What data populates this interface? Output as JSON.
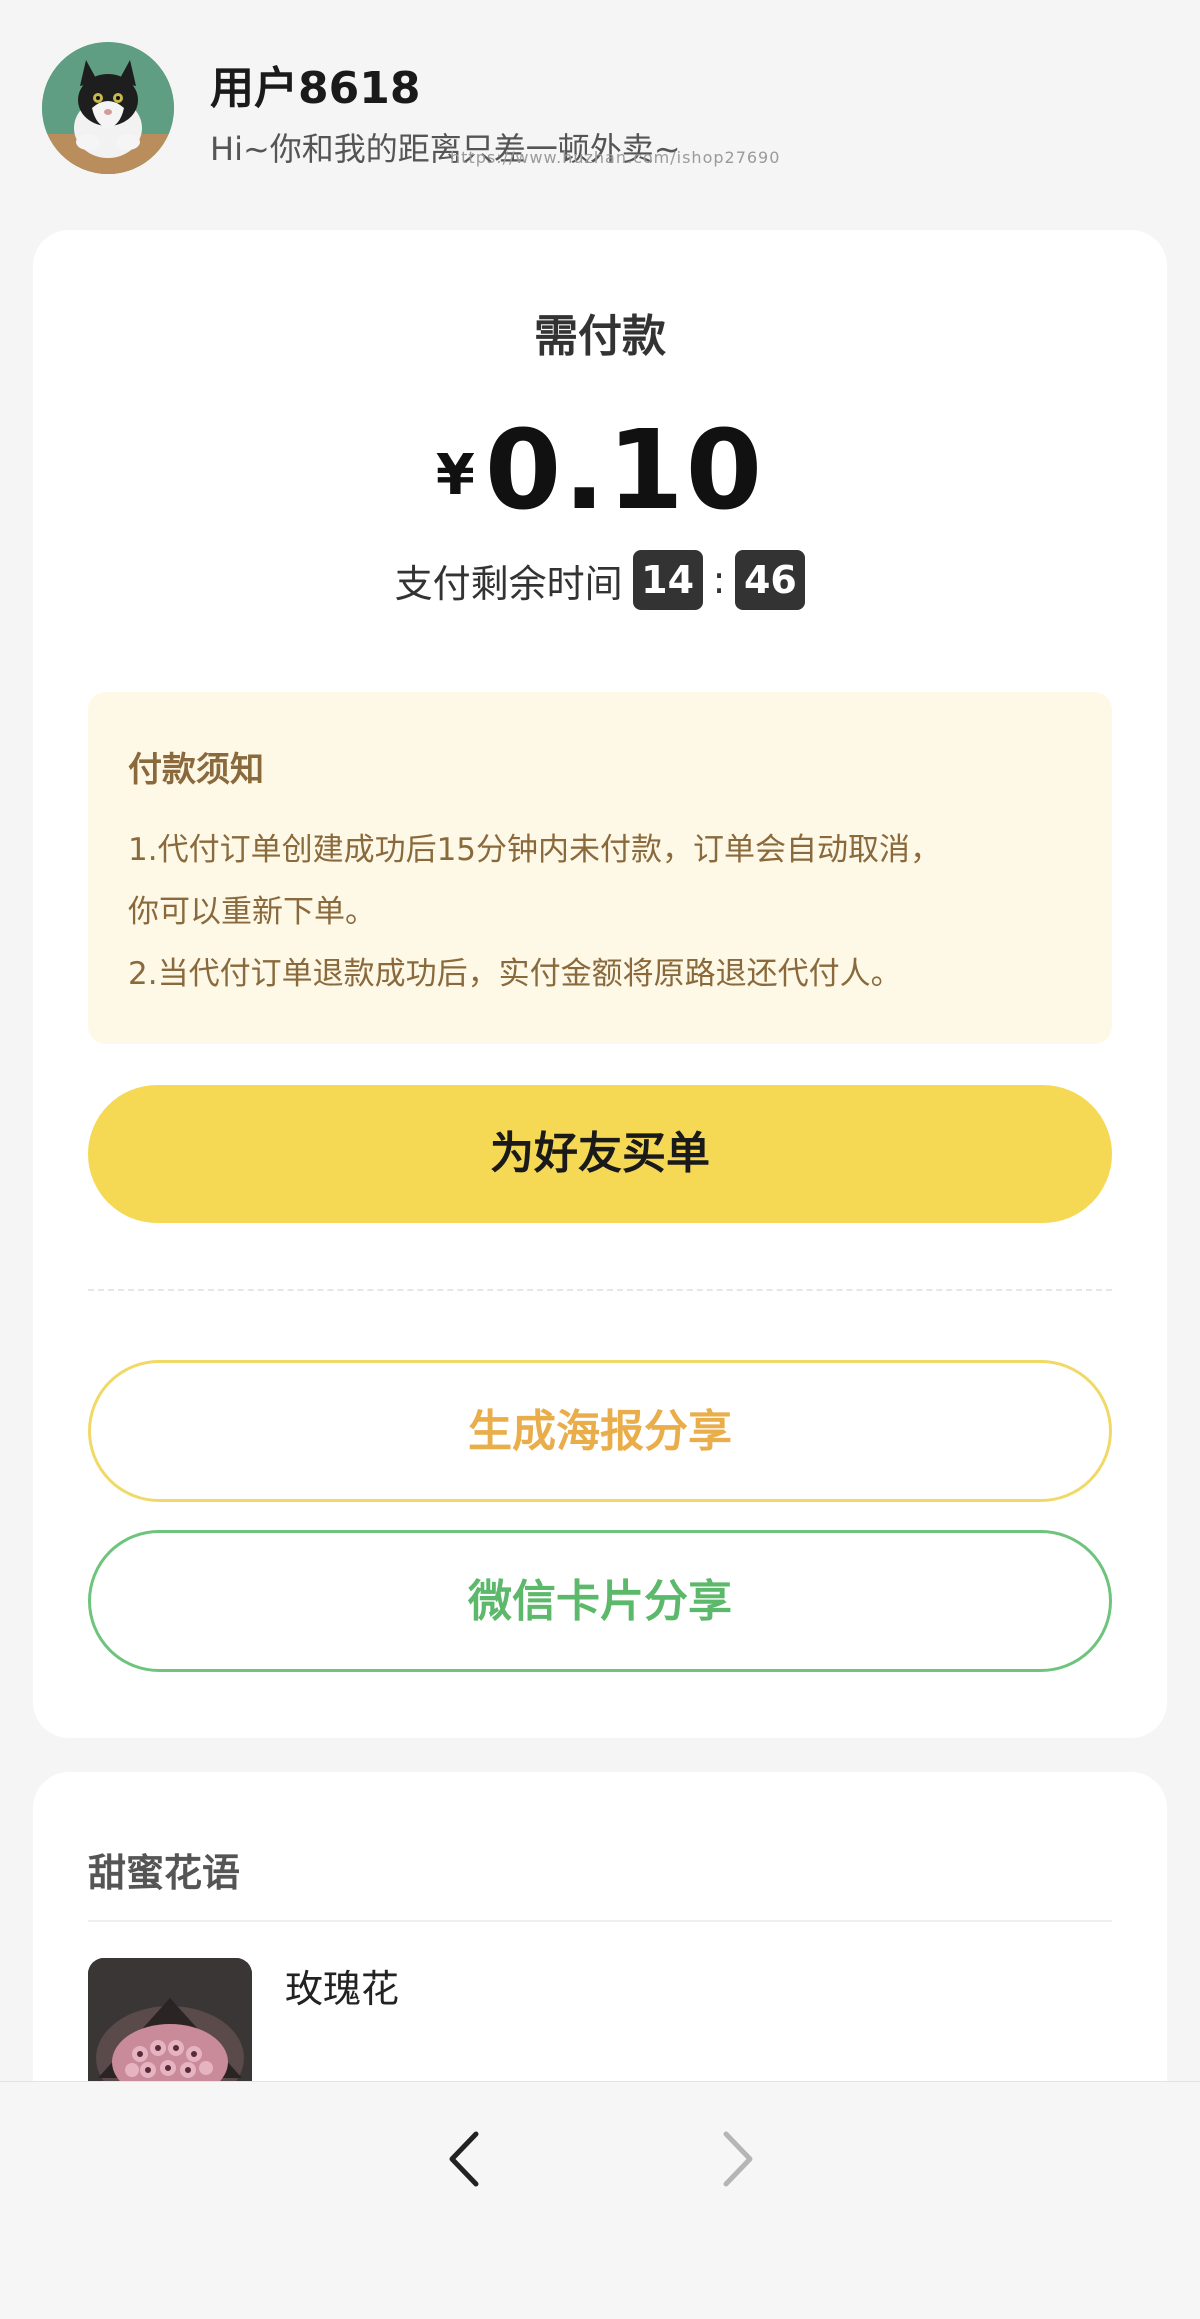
{
  "header": {
    "user_name": "用户8618",
    "greeting": "Hi~你和我的距离只差一顿外卖~",
    "watermark": "https://www.huzhan.com/ishop27690"
  },
  "payment": {
    "title": "需付款",
    "currency_symbol": "¥",
    "amount": "0.10",
    "timer_label": "支付剩余时间",
    "timer_minutes": "14",
    "timer_separator": ":",
    "timer_seconds": "46"
  },
  "notice": {
    "title": "付款须知",
    "lines": [
      "1.代付订单创建成功后15分钟内未付款，订单会自动取消，",
      "你可以重新下单。",
      "2.当代付订单退款成功后，实付金额将原路退还代付人。"
    ]
  },
  "actions": {
    "pay_for_friend": "为好友买单",
    "generate_poster": "生成海报分享",
    "wechat_card": "微信卡片分享"
  },
  "gift_section": {
    "title": "甜蜜花语",
    "items": [
      {
        "name": "玫瑰花"
      }
    ]
  },
  "colors": {
    "accent_yellow": "#f5d955",
    "poster_text": "#e9ad4a",
    "wechat_green": "#5cb86a",
    "notice_bg": "#fef8e7"
  },
  "icons": {
    "back": "chevron-left-icon",
    "forward": "chevron-right-icon"
  }
}
